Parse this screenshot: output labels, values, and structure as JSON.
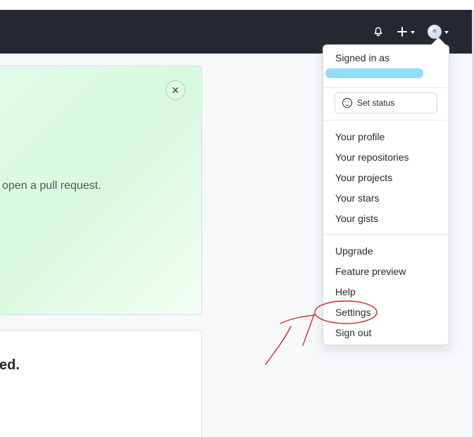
{
  "header": {
    "icons": [
      "bell-icon",
      "plus-icon",
      "avatar-icon"
    ]
  },
  "main": {
    "promo_text": "open a pull request.",
    "close_label": "×",
    "second_card_text": "ed."
  },
  "dropdown": {
    "signed_in_label": "Signed in as",
    "status_label": "Set status",
    "items": [
      {
        "label": "Your profile"
      },
      {
        "label": "Your repositories"
      },
      {
        "label": "Your projects"
      },
      {
        "label": "Your stars"
      },
      {
        "label": "Your gists"
      },
      {
        "label": "Upgrade"
      },
      {
        "label": "Feature preview"
      },
      {
        "label": "Help"
      },
      {
        "label": "Settings"
      },
      {
        "label": "Sign out"
      }
    ]
  },
  "colors": {
    "header_bg": "#24292f",
    "promo_bg": "#dffce8",
    "annotation": "#d22b2b",
    "name_redaction": "#8dd9ff"
  }
}
